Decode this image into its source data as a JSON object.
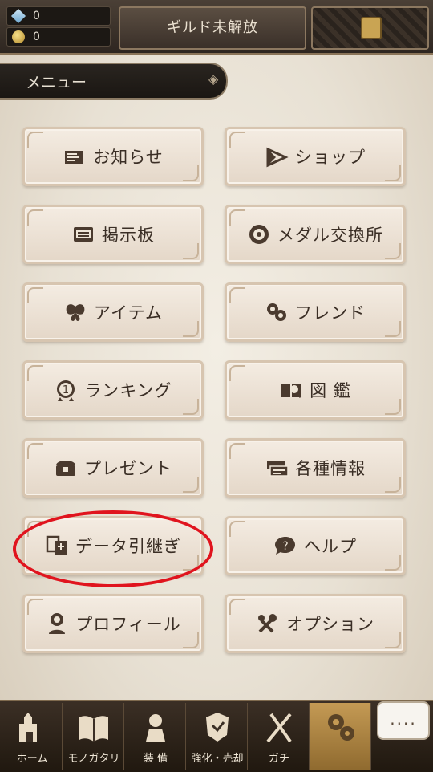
{
  "currency": {
    "gems": "0",
    "coins": "0"
  },
  "guild_button": "ギルド未解放",
  "menu_header": "メニュー",
  "menu": [
    {
      "label": "お知らせ",
      "icon": "news-icon"
    },
    {
      "label": "ショップ",
      "icon": "shop-icon"
    },
    {
      "label": "掲示板",
      "icon": "bulletin-board-icon"
    },
    {
      "label": "メダル交換所",
      "icon": "medal-exchange-icon"
    },
    {
      "label": "アイテム",
      "icon": "butterfly-icon"
    },
    {
      "label": "フレンド",
      "icon": "friends-icon"
    },
    {
      "label": "ランキング",
      "icon": "ranking-medal-icon"
    },
    {
      "label": "図 鑑",
      "icon": "encyclopedia-icon"
    },
    {
      "label": "プレゼント",
      "icon": "present-chest-icon"
    },
    {
      "label": "各種情報",
      "icon": "info-cards-icon"
    },
    {
      "label": "データ引継ぎ",
      "icon": "data-transfer-icon"
    },
    {
      "label": "ヘルプ",
      "icon": "help-icon"
    },
    {
      "label": "プロフィール",
      "icon": "profile-icon"
    },
    {
      "label": "オプション",
      "icon": "options-tools-icon"
    }
  ],
  "bottom_nav": [
    {
      "label": "ホーム",
      "icon": "castle-icon"
    },
    {
      "label": "モノガタリ",
      "icon": "book-icon"
    },
    {
      "label": "装 備",
      "icon": "equipment-icon"
    },
    {
      "label": "強化・売却",
      "icon": "enhance-icon"
    },
    {
      "label": "ガチ",
      "icon": "gacha-icon"
    },
    {
      "label": "",
      "icon": "settings-gears-icon"
    }
  ],
  "chat_button": "...."
}
